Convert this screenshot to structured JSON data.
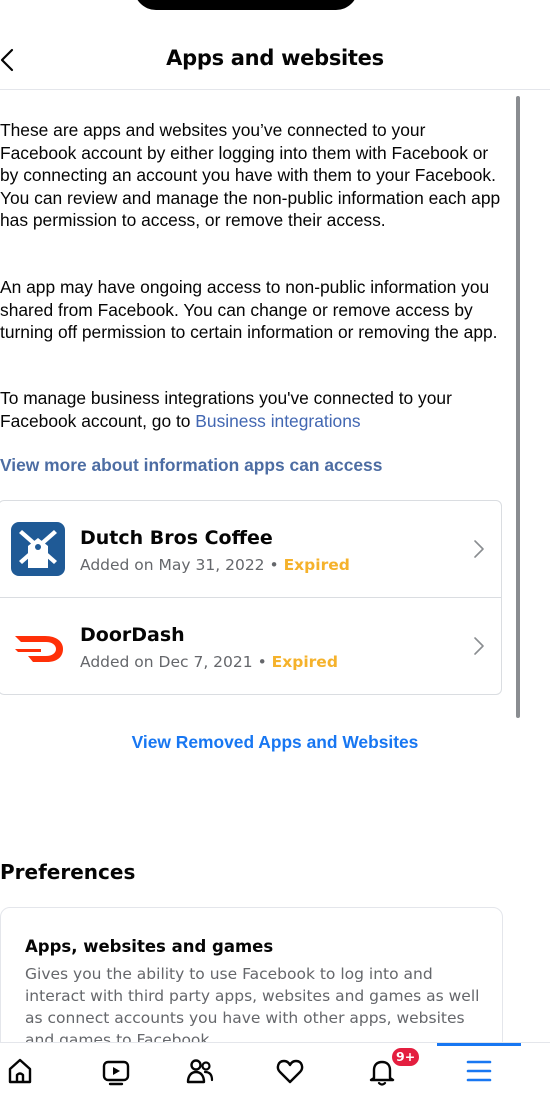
{
  "header": {
    "title": "Apps and websites",
    "back_icon": "chevron-left-icon"
  },
  "intro": {
    "paragraph_1": "These are apps and websites you’ve connected to your Facebook account by either logging into them with Facebook or by connecting an account you have with them to your Facebook. You can review and manage the non-public information each app has permission to access, or remove their access.",
    "paragraph_2": "An app may have ongoing access to non-public information you shared from Facebook. You can change or remove access by turning off permission to certain information or removing the app.",
    "paragraph_3_prefix": "To manage business integrations you've connected to your Facebook account, go to ",
    "paragraph_3_link": "Business integrations"
  },
  "view_more_link": "View more about information apps can access",
  "apps": [
    {
      "name": "Dutch Bros Coffee",
      "added": "Added on May 31, 2022",
      "separator": "•",
      "status": "Expired",
      "icon": "windmill-icon",
      "icon_color": "#1f5a96"
    },
    {
      "name": "DoorDash",
      "added": "Added on Dec 7, 2021",
      "separator": "•",
      "status": "Expired",
      "icon": "doordash-icon",
      "icon_color": "#ff3008"
    }
  ],
  "view_removed_link": "View Removed Apps and Websites",
  "preferences": {
    "heading": "Preferences",
    "card_title": "Apps, websites and games",
    "card_description": "Gives you the ability to use Facebook to log into and interact with third party apps, websites and games as well as connect accounts you have with other apps, websites and games to Facebook."
  },
  "tabbar": {
    "items": [
      {
        "icon": "home-icon"
      },
      {
        "icon": "video-icon"
      },
      {
        "icon": "friends-icon"
      },
      {
        "icon": "dating-heart-icon"
      },
      {
        "icon": "bell-icon",
        "badge": "9+"
      },
      {
        "icon": "menu-icon",
        "active": true
      }
    ]
  },
  "colors": {
    "link_blue": "#1877f2",
    "link_muted_blue": "#4d6da3",
    "expired_amber": "#f5b22b",
    "badge_red": "#e41e3f"
  }
}
